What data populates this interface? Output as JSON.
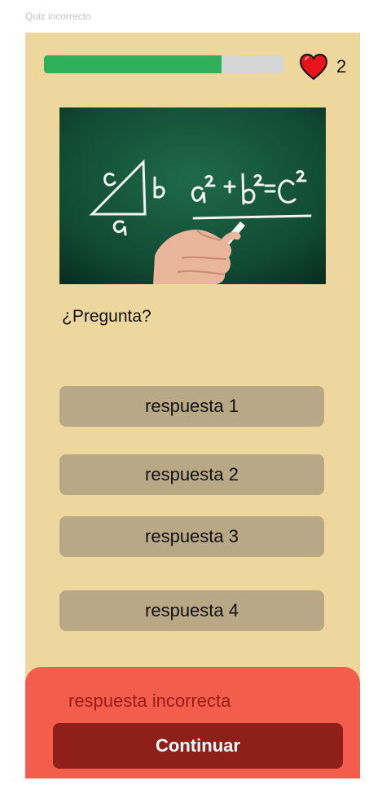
{
  "frame": {
    "label": "Quiz incorrecto"
  },
  "header": {
    "progress_fraction": 0.74,
    "lives": "2"
  },
  "question": {
    "image_icon": "chalkboard-pythagoras-image",
    "text": "¿Pregunta?"
  },
  "answers": [
    {
      "label": "respuesta 1"
    },
    {
      "label": "respuesta 2"
    },
    {
      "label": "respuesta 3"
    },
    {
      "label": "respuesta 4"
    }
  ],
  "feedback": {
    "message": "respuesta incorrecta",
    "button_label": "Continuar"
  },
  "colors": {
    "background": "#edd79c",
    "progress": "#2fb05a",
    "progress_track": "#d6d6d6",
    "answer": "#b9a886",
    "feedback_panel": "#f45d4c",
    "feedback_text": "#9a1d16",
    "continue_button": "#8f1f19",
    "heart": "#e8141c"
  }
}
